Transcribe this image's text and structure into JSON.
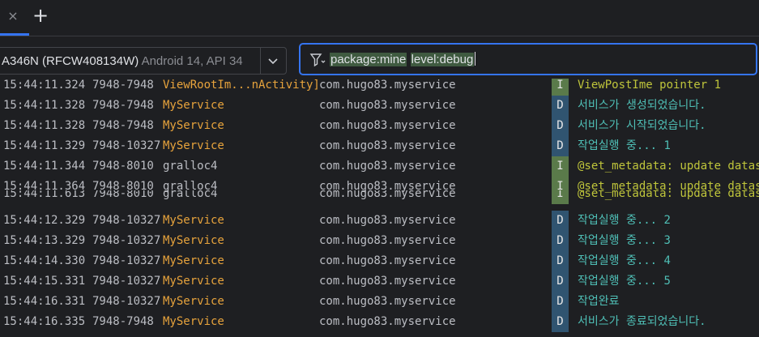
{
  "tabs": {
    "close_symbol": "×",
    "add_symbol": "+"
  },
  "device": {
    "name": "A346N (RFCW408134W)",
    "meta": "Android 14, API 34"
  },
  "filter": {
    "token1": "package:mine",
    "token2": "level:debug"
  },
  "colors": {
    "accent": "#3574f0",
    "tag_app": "#e7a33c",
    "debug_msg": "#4fbfb6",
    "info_msg": "#bfc53b",
    "debug_badge": "#305470",
    "info_badge": "#5a7a4a"
  },
  "logs": [
    {
      "time": "15:44:11.324",
      "pid": "7948-7948",
      "tag": "ViewRootIm...nActivity]",
      "pkg": "com.hugo83.myservice",
      "level": "I",
      "msg": "ViewPostIme pointer 1"
    },
    {
      "time": "15:44:11.328",
      "pid": "7948-7948",
      "tag": "MyService",
      "pkg": "com.hugo83.myservice",
      "level": "D",
      "msg": "서비스가 생성되었습니다."
    },
    {
      "time": "15:44:11.328",
      "pid": "7948-7948",
      "tag": "MyService",
      "pkg": "com.hugo83.myservice",
      "level": "D",
      "msg": "서비스가 시작되었습니다."
    },
    {
      "time": "15:44:11.329",
      "pid": "7948-10327",
      "tag": "MyService",
      "pkg": "com.hugo83.myservice",
      "level": "D",
      "msg": "작업실행 중... 1"
    },
    {
      "time": "15:44:11.344",
      "pid": "7948-8010",
      "tag": "gralloc4",
      "pkg": "com.hugo83.myservice",
      "level": "I",
      "msg": "@set_metadata: update datasp"
    },
    {
      "time": "15:44:11.364",
      "pid": "7948-8010",
      "tag": "gralloc4",
      "pkg": "com.hugo83.myservice",
      "level": "I",
      "msg": "@set_metadata: update datasp"
    },
    {
      "time": "15:44:11.613",
      "pid": "7948-8010",
      "tag": "gralloc4",
      "pkg": "com.hugo83.myservice",
      "level": "I",
      "msg": "@set_metadata: update datasp"
    },
    {
      "time": "15:44:12.329",
      "pid": "7948-10327",
      "tag": "MyService",
      "pkg": "com.hugo83.myservice",
      "level": "D",
      "msg": "작업실행 중... 2"
    },
    {
      "time": "15:44:13.329",
      "pid": "7948-10327",
      "tag": "MyService",
      "pkg": "com.hugo83.myservice",
      "level": "D",
      "msg": "작업실행 중... 3"
    },
    {
      "time": "15:44:14.330",
      "pid": "7948-10327",
      "tag": "MyService",
      "pkg": "com.hugo83.myservice",
      "level": "D",
      "msg": "작업실행 중... 4"
    },
    {
      "time": "15:44:15.331",
      "pid": "7948-10327",
      "tag": "MyService",
      "pkg": "com.hugo83.myservice",
      "level": "D",
      "msg": "작업실행 중... 5"
    },
    {
      "time": "15:44:16.331",
      "pid": "7948-10327",
      "tag": "MyService",
      "pkg": "com.hugo83.myservice",
      "level": "D",
      "msg": "작업완료"
    },
    {
      "time": "15:44:16.335",
      "pid": "7948-7948",
      "tag": "MyService",
      "pkg": "com.hugo83.myservice",
      "level": "D",
      "msg": "서비스가 종료되었습니다."
    }
  ]
}
